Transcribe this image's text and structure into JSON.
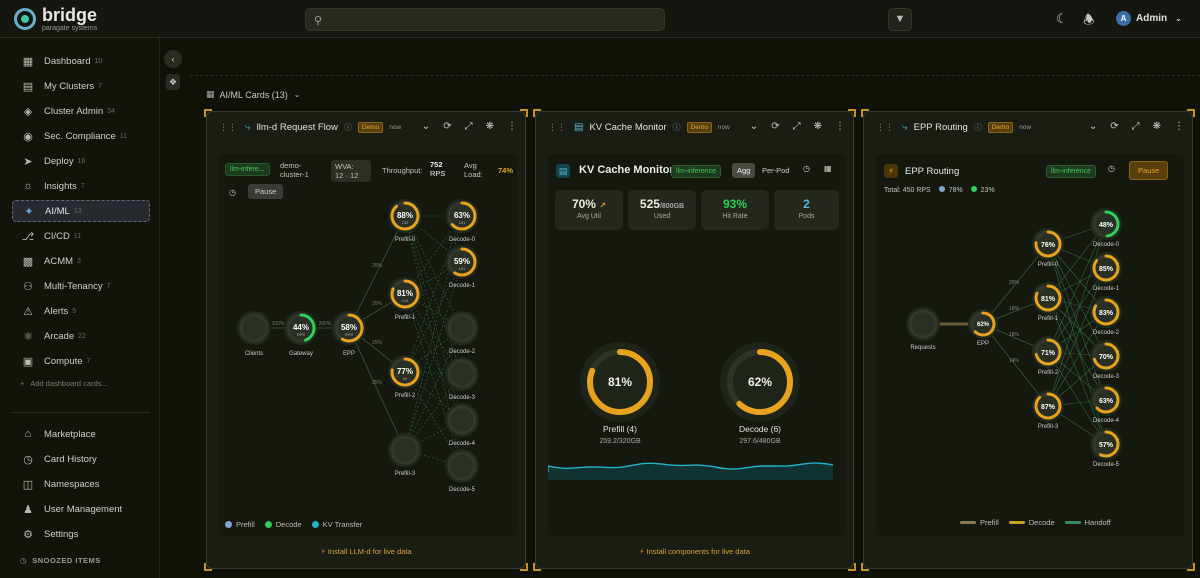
{
  "app": {
    "title": "bridge",
    "subtitle": "paragate systems",
    "user": "Admin",
    "user_initial": "A"
  },
  "sidebar": {
    "items": [
      {
        "label": "Dashboard",
        "count": "10",
        "icon": "grid-icon"
      },
      {
        "label": "My Clusters",
        "count": "7",
        "icon": "server-icon"
      },
      {
        "label": "Cluster Admin",
        "count": "34",
        "icon": "shield-icon"
      },
      {
        "label": "Sec. Compliance",
        "count": "11",
        "icon": "shield-check-icon"
      },
      {
        "label": "Deploy",
        "count": "16",
        "icon": "rocket-icon"
      },
      {
        "label": "Insights",
        "count": "7",
        "icon": "lightbulb-icon"
      },
      {
        "label": "AI/ML",
        "count": "13",
        "icon": "sparkle-icon"
      },
      {
        "label": "CI/CD",
        "count": "11",
        "icon": "git-icon"
      },
      {
        "label": "ACMM",
        "count": "3",
        "icon": "chart-icon"
      },
      {
        "label": "Multi-Tenancy",
        "count": "7",
        "icon": "users-icon"
      },
      {
        "label": "Alerts",
        "count": "5",
        "icon": "bell-icon"
      },
      {
        "label": "Arcade",
        "count": "22",
        "icon": "gamepad-icon"
      },
      {
        "label": "Compute",
        "count": "7",
        "icon": "cpu-icon"
      }
    ],
    "add_label": "Add dashboard cards...",
    "bottom": [
      {
        "label": "Marketplace",
        "icon": "store-icon"
      },
      {
        "label": "Card History",
        "icon": "history-icon"
      },
      {
        "label": "Namespaces",
        "icon": "folder-icon"
      },
      {
        "label": "User Management",
        "icon": "user-icon"
      },
      {
        "label": "Settings",
        "icon": "gear-icon"
      }
    ],
    "snoozed": "SNOOZED ITEMS"
  },
  "section_title": "AI/ML Cards (13)",
  "cards": [
    {
      "title": "llm-d Request Flow",
      "badge": "Demo",
      "time": "now",
      "footer": "Install LLM-d for live data",
      "chip": "llm-infere...",
      "cluster": "demo-cluster-1",
      "wva_label": "WVA:",
      "wva_value": "12 · 12",
      "throughput_label": "Throughput:",
      "throughput_value": "752",
      "throughput_unit": "RPS",
      "load_label": "Avg Load:",
      "load_value": "74%",
      "pause": "Pause",
      "nodes": {
        "clients": "Clients",
        "gateway": "Gateway",
        "gateway_pct": "44%",
        "gateway_sub": "RPS",
        "epp": "EPP",
        "epp_pct": "58%",
        "epp_sub": "RPS",
        "prefill": [
          {
            "name": "Prefill-0",
            "pct": "88%",
            "sub": "132",
            "level": 0.88
          },
          {
            "name": "Prefill-1",
            "pct": "81%",
            "sub": "128",
            "level": 0.81
          },
          {
            "name": "Prefill-2",
            "pct": "77%",
            "sub": "99",
            "level": 0.77
          },
          {
            "name": "Prefill-3",
            "pct": "",
            "sub": "",
            "level": 0
          }
        ],
        "decode": [
          {
            "name": "Decode-0",
            "pct": "63%",
            "sub": "181",
            "level": 0.63
          },
          {
            "name": "Decode-1",
            "pct": "59%",
            "sub": "181",
            "level": 0.59
          },
          {
            "name": "Decode-2",
            "pct": "",
            "sub": "",
            "level": 0
          },
          {
            "name": "Decode-3",
            "pct": "",
            "sub": "",
            "level": 0
          },
          {
            "name": "Decode-4",
            "pct": "",
            "sub": "",
            "level": 0
          },
          {
            "name": "Decode-5",
            "pct": "",
            "sub": "",
            "level": 0
          }
        ],
        "edge_labels": [
          "100%",
          "200%",
          "25%",
          "25%",
          "25%",
          "25%"
        ]
      },
      "legend": [
        "Prefill",
        "Decode",
        "KV Transfer"
      ]
    },
    {
      "title": "KV Cache Monitor",
      "badge": "Demo",
      "time": "now",
      "footer": "Install components for live data",
      "inner_title": "KV Cache Monitor",
      "chip": "llm-inference",
      "agg": "Agg",
      "perpod": "Per-Pod",
      "stats": [
        {
          "value": "70%",
          "label": "Avg Util",
          "trend": "↗"
        },
        {
          "value": "525",
          "unit": "/800GB",
          "label": "Used"
        },
        {
          "value": "93%",
          "label": "Hit Rate"
        },
        {
          "value": "2",
          "label": "Pods"
        }
      ],
      "gauges": [
        {
          "pct": "81%",
          "level": 0.81,
          "name": "Prefill (4)",
          "detail": "259.2/320GB"
        },
        {
          "pct": "62%",
          "level": 0.62,
          "name": "Decode (6)",
          "detail": "297.6/480GB"
        }
      ]
    },
    {
      "title": "EPP Routing",
      "badge": "Demo",
      "time": "now",
      "footer": "",
      "inner_title": "EPP Routing",
      "chip": "llm-inference",
      "pause": "Pause",
      "total_label": "Total:",
      "total_value": "450",
      "total_unit": "RPS",
      "pct_a": "78%",
      "pct_b": "23%",
      "nodes": {
        "requests": "Requests",
        "epp": "EPP",
        "epp_pct": "62%",
        "prefill": [
          {
            "name": "Prefill-0",
            "pct": "76%",
            "level": 0.76
          },
          {
            "name": "Prefill-1",
            "pct": "81%",
            "level": 0.81
          },
          {
            "name": "Prefill-2",
            "pct": "71%",
            "level": 0.71
          },
          {
            "name": "Prefill-3",
            "pct": "87%",
            "level": 0.87
          }
        ],
        "decode": [
          {
            "name": "Decode-0",
            "pct": "48%",
            "level": 0.48
          },
          {
            "name": "Decode-1",
            "pct": "85%",
            "level": 0.85
          },
          {
            "name": "Decode-2",
            "pct": "83%",
            "level": 0.83
          },
          {
            "name": "Decode-3",
            "pct": "70%",
            "level": 0.7
          },
          {
            "name": "Decode-4",
            "pct": "63%",
            "level": 0.63
          },
          {
            "name": "Decode-5",
            "pct": "57%",
            "level": 0.57
          }
        ],
        "edge_labels": [
          "20%",
          "18%",
          "18%",
          "14%"
        ]
      },
      "legend": [
        "Prefill",
        "Decode",
        "Handoff"
      ]
    }
  ],
  "colors": {
    "accent": "#e9a21f",
    "green": "#2fcf5a",
    "blue": "#58b6d8",
    "cyan": "#22b3c9"
  }
}
